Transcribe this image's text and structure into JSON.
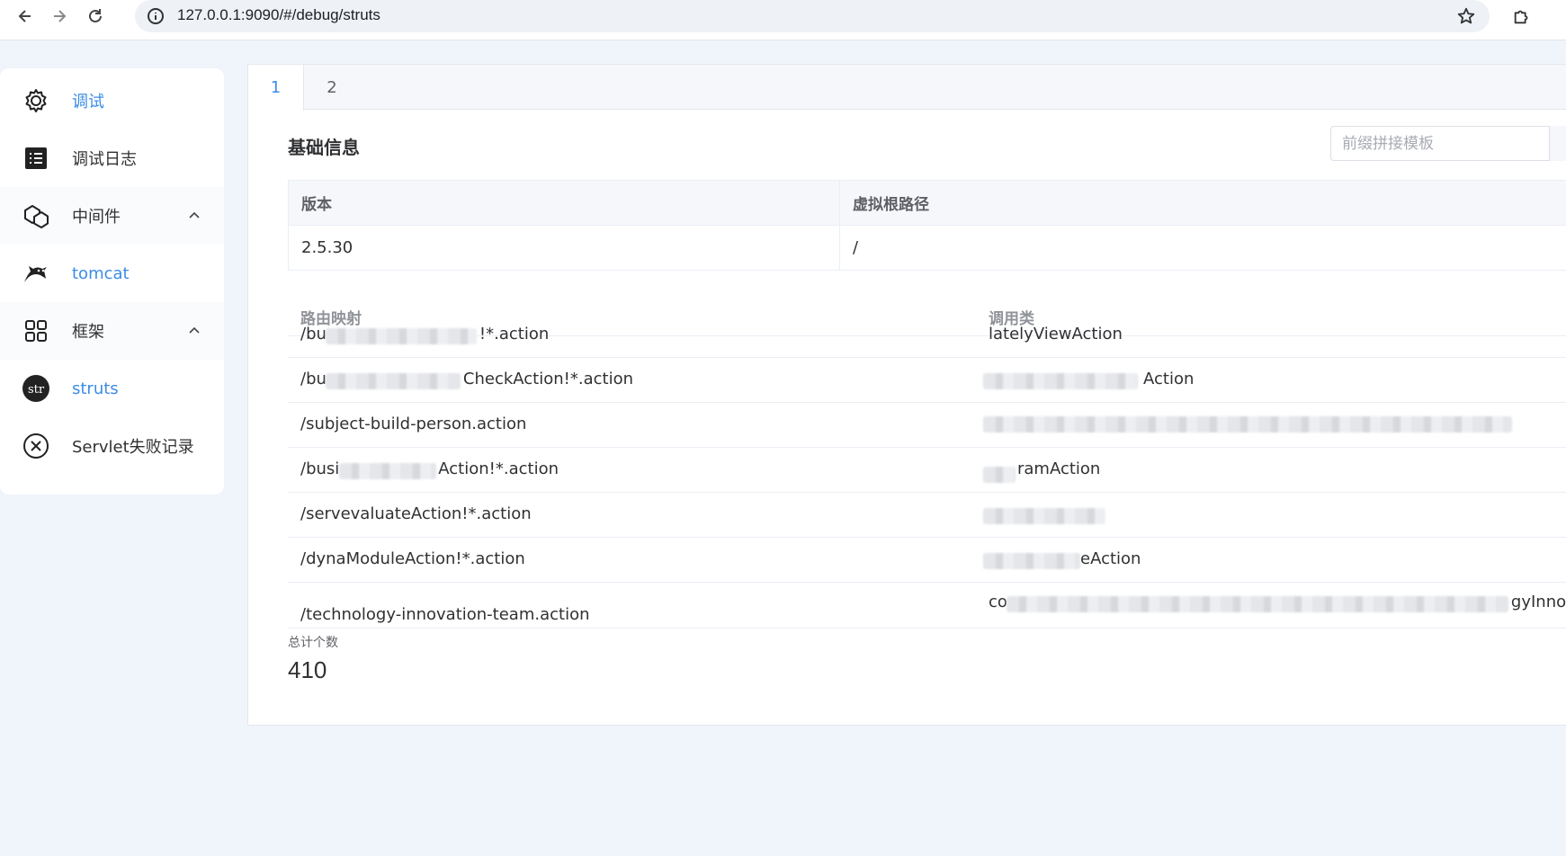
{
  "browser": {
    "url": "127.0.0.1:9090/#/debug/struts",
    "back_icon": "arrow-left-icon",
    "forward_icon": "arrow-right-icon",
    "reload_icon": "reload-icon",
    "bookmark_icon": "star-icon",
    "extensions_icon": "puzzle-icon"
  },
  "sidebar": {
    "items": [
      {
        "label": "调试",
        "icon": "gear-icon",
        "active": true
      },
      {
        "label": "调试日志",
        "icon": "log-icon",
        "active": false
      },
      {
        "label": "中间件",
        "icon": "middleware-icon",
        "active": false,
        "expanded": true
      },
      {
        "label": "tomcat",
        "icon": "tomcat-icon",
        "active": true
      },
      {
        "label": "框架",
        "icon": "grid-icon",
        "active": false,
        "expanded": true
      },
      {
        "label": "struts",
        "icon": "struts-icon",
        "active": true
      },
      {
        "label": "Servlet失败记录",
        "icon": "close-circle-icon",
        "active": false
      }
    ]
  },
  "tabs": [
    {
      "label": "1",
      "active": true
    },
    {
      "label": "2",
      "active": false
    }
  ],
  "basic_info": {
    "title": "基础信息",
    "search_placeholder": "前缀拼接模板",
    "headers": [
      "版本",
      "虚拟根路径"
    ],
    "values": [
      "2.5.30",
      "/"
    ]
  },
  "routes": {
    "headers": [
      "路由映射",
      "调用类"
    ],
    "rows": [
      {
        "path": "/bu",
        "path_suffix": "!*.action",
        "class": "latelyViewAction",
        "class_suffix": ""
      },
      {
        "path": "/bu",
        "path_suffix": "CheckAction!*.action",
        "class": "",
        "class_suffix": "Action"
      },
      {
        "path": "/subject-build-person.action",
        "path_suffix": "",
        "class": "",
        "class_suffix": ""
      },
      {
        "path": "/busi",
        "path_suffix": "Action!*.action",
        "class": "",
        "class_suffix": "ramAction"
      },
      {
        "path": "/servevaluateAction!*.action",
        "path_suffix": "",
        "class": "",
        "class_suffix": ""
      },
      {
        "path": "/dynaModuleAction!*.action",
        "path_suffix": "",
        "class": "",
        "class_suffix": "eAction"
      },
      {
        "path": "/technology-innovation-team.action",
        "path_suffix": "",
        "class": "co",
        "class_suffix": "gyInnovat"
      }
    ]
  },
  "total": {
    "label": "总计个数",
    "value": "410"
  },
  "colors": {
    "accent": "#3b8de6",
    "page_bg": "#f0f4fb"
  }
}
